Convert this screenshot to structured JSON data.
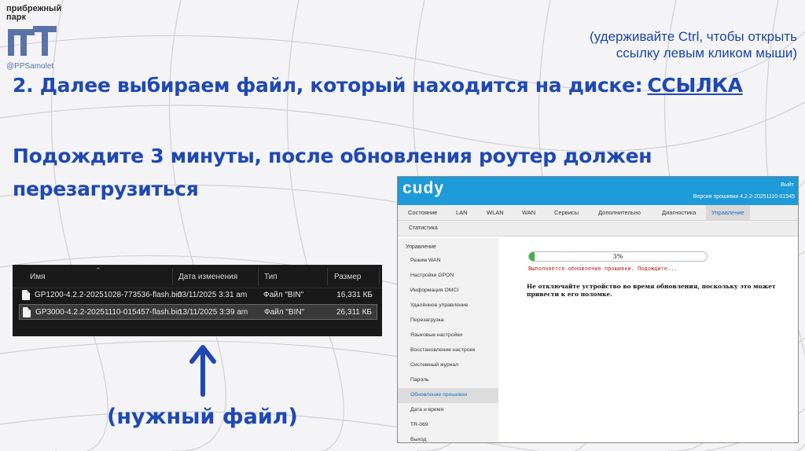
{
  "logo": {
    "line1": "прибрежный",
    "line2": "парк",
    "handle": "@PPSamolet"
  },
  "hint": {
    "line1": "(удерживайте Ctrl, чтобы открыть",
    "line2": "ссылку левым кликом мыши)"
  },
  "heading1": {
    "text": "2. Далее выбираем файл, который находится на диске:",
    "link": "ССЫЛКА"
  },
  "heading2": {
    "line1": "Подождите 3 минуты, после обновления роутер должен",
    "line2": "перезагрузиться"
  },
  "explorer": {
    "columns": [
      "Имя",
      "Дата изменения",
      "Тип",
      "Размер"
    ],
    "rows": [
      {
        "name": "GP1200-4.2.2-20251028-773536-flash.bin",
        "date": "03/11/2025 3:31 am",
        "type": "Файл \"BIN\"",
        "size": "16,331 КБ"
      },
      {
        "name": "GP3000-4.2.2-20251110-015457-flash.bin",
        "date": "13/11/2025 3:39 am",
        "type": "Файл \"BIN\"",
        "size": "26,311 КБ"
      }
    ]
  },
  "caption": "(нужный файл)",
  "router": {
    "logo": "cudy",
    "exit": "Выйт",
    "firmware_version": "Версия прошивки 4.2.2-20251110-01545",
    "tabs": [
      "Состояние",
      "LAN",
      "WLAN",
      "WAN",
      "Сервисы",
      "Дополнительно",
      "Диагностика",
      "Управление"
    ],
    "subtab": "Статистика",
    "sidebar_title": "Управление",
    "sidebar": [
      "Режим WAN",
      "Настройки GPON",
      "Информация OMCI",
      "Удалённое управление",
      "Перезагрузка",
      "Языковые настройки",
      "Восстановление настроек",
      "Системный журнал",
      "Пароль",
      "Обновление прошивки",
      "Дата и время",
      "TR-069",
      "Выход"
    ],
    "progress_text": "3%",
    "progress_value": 0.03,
    "status": "Выполняется обновление прошивки. Подождите...",
    "warning": "Не отключайте устройство во время обновления, поскольку это может привести к его поломке.",
    "accent": "#1d9ad7",
    "progress_color": "#3fb24a"
  },
  "colors": {
    "heading": "#1f48b5",
    "hint": "#1c45a8"
  }
}
